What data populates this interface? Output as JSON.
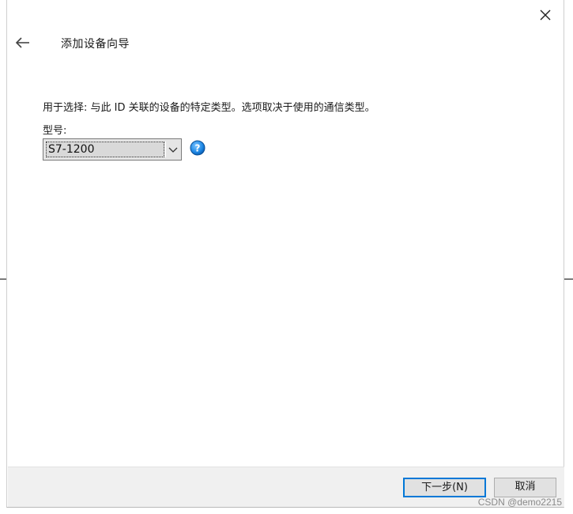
{
  "dialog": {
    "title": "添加设备向导",
    "description": "用于选择: 与此 ID 关联的设备的特定类型。选项取决于使用的通信类型。",
    "model_label": "型号:",
    "model_select": {
      "value": "S7-1200"
    },
    "icons": {
      "back": "back-arrow-icon",
      "close": "close-icon",
      "help": "help-icon",
      "dropdown": "chevron-down-icon"
    }
  },
  "footer": {
    "next_label": "下一步(N)",
    "cancel_label": "取消"
  },
  "watermark": "CSDN @demo2215",
  "colors": {
    "accent": "#0078d7",
    "footer_bg": "#f0f0f0",
    "help_icon": "#1e88e5"
  }
}
